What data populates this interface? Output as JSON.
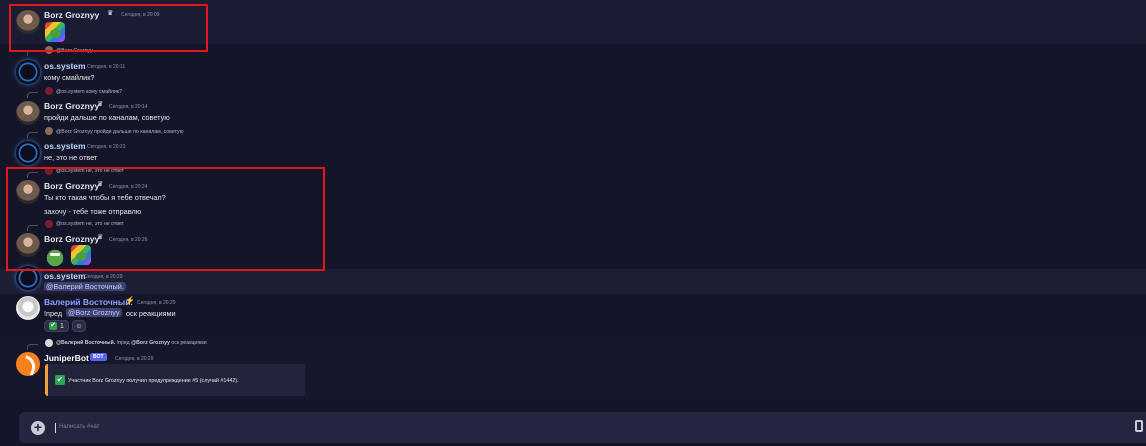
{
  "colors": {
    "background": "#15152a",
    "highlight_box": "#e3161b",
    "mention_bg": "#3c4270",
    "embed_accent": "#f0a23c",
    "bot_tag": "#5865f2"
  },
  "messages": {
    "m1": {
      "author": "Borz Groznyy",
      "time": "Сегодня, в 20:09",
      "emojis": [
        "pepe-rainbow-emoji"
      ]
    },
    "m2": {
      "reply": "@Borz Groznyy",
      "author": "os.system",
      "time": "Сегодня, в 20:11",
      "text": "кому смайлик?"
    },
    "m3": {
      "reply": "@os.system кому смайлик?",
      "author": "Borz Groznyy",
      "time": "Сегодня, в 20:14",
      "text": "пройди дальше по каналам, советую"
    },
    "m4": {
      "reply": "@Borz Groznyy пройди дальше по каналам, советую",
      "author": "os.system",
      "time": "Сегодня, в 20:23",
      "text": "не, это не ответ"
    },
    "m5": {
      "reply": "@os.system не, это не ответ",
      "author": "Borz Groznyy",
      "time": "Сегодня, в 20:24",
      "text": "Ты кто такая чтобы я тебе отвечал?",
      "text2": "захочу - тебе тоже отправлю"
    },
    "m6": {
      "reply": "@os.system не, это не ответ",
      "author": "Borz Groznyy",
      "time": "Сегодня, в 20:26",
      "emojis": [
        "pepe-green-emoji",
        "pepe-rainbow-emoji"
      ]
    },
    "m7": {
      "author": "os.system",
      "time": "Сегодня, в 20:29",
      "mention": "@Валерий Восточный."
    },
    "m8": {
      "author": "Валерий Восточный.",
      "time": "Сегодня, в 20:29",
      "text_prefix": "!пред",
      "mention": "@Borz Groznyy",
      "text_suffix": "оск реакциями",
      "reaction_count": "1"
    },
    "m9": {
      "reply_author": "@Валерий Восточный.",
      "reply_text": "!пред",
      "reply_mention": "@Borz Groznyy",
      "reply_suffix": "оск реакциями",
      "author": "JuniperBot",
      "bot_tag": "BOT",
      "time": "Сегодня, в 20:29",
      "embed_text": "Участник Borz Groznyy получил предупреждение #5 (случай #1442)."
    }
  },
  "input": {
    "placeholder": "Написать #чат"
  },
  "icons": {
    "crown": "♛",
    "bolt": "⚡",
    "check": "✔",
    "plus": "+",
    "smile": "☺"
  }
}
